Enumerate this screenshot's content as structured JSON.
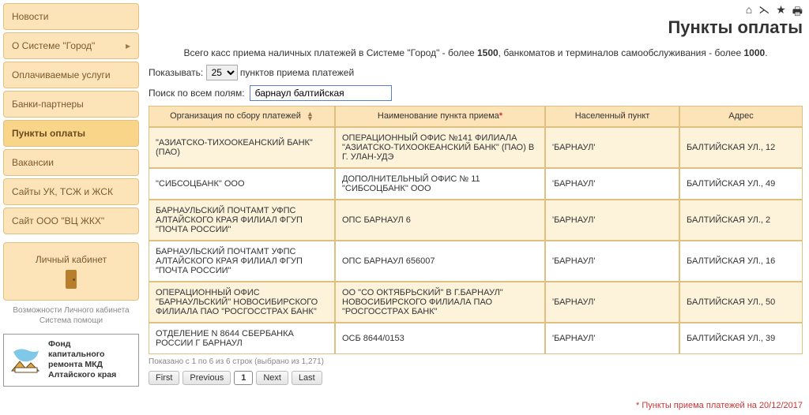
{
  "top_icons": [
    "home",
    "rss",
    "star",
    "print"
  ],
  "page_title": "Пункты оплаты",
  "menu": [
    {
      "label": "Новости",
      "children": false,
      "active": false
    },
    {
      "label": "О Системе \"Город\"",
      "children": true,
      "active": false
    },
    {
      "label": "Оплачиваемые услуги",
      "children": false,
      "active": false
    },
    {
      "label": "Банки-партнеры",
      "children": false,
      "active": false
    },
    {
      "label": "Пункты оплаты",
      "children": false,
      "active": true
    },
    {
      "label": "Вакансии",
      "children": false,
      "active": false
    },
    {
      "label": "Сайты УК, ТСЖ и ЖСК",
      "children": false,
      "active": false
    },
    {
      "label": "Сайт ООО \"ВЦ ЖКХ\"",
      "children": false,
      "active": false
    }
  ],
  "cabinet_label": "Личный кабинет",
  "cabinet_hint": "Возможности Личного кабинета\nСистема помощи",
  "logo_lines": {
    "l1": "Фонд",
    "l2": "капитального",
    "l3": "ремонта МКД",
    "l4": "Алтайского края"
  },
  "intro": {
    "pre": "Всего касс приема наличных платежей в Системе \"Город\" - более ",
    "b1": "1500",
    "mid": ", банкоматов и терминалов самообслуживания - более ",
    "b2": "1000",
    "post": "."
  },
  "show": {
    "label_pre": "Показывать:",
    "value": "25",
    "label_post": "пунктов приема платежей"
  },
  "search": {
    "label": "Поиск по всем полям:",
    "value": "барнаул балтийская"
  },
  "columns": {
    "org": "Организация по сбору платежей",
    "name": "Наименование пункта приема",
    "city": "Населенный пункт",
    "addr": "Адрес"
  },
  "rows": [
    {
      "org": "\"АЗИАТСКО-ТИХООКЕАНСКИЙ БАНК\" (ПАО)",
      "name": "ОПЕРАЦИОННЫЙ ОФИС №141 ФИЛИАЛА \"АЗИАТСКО-ТИХООКЕАНСКИЙ БАНК\" (ПАО) В Г. УЛАН-УДЭ",
      "city": "'БАРНАУЛ'",
      "addr": "БАЛТИЙСКАЯ УЛ., 12"
    },
    {
      "org": "\"СИБСОЦБАНК\" ООО",
      "name": "ДОПОЛНИТЕЛЬНЫЙ ОФИС № 11 \"СИБСОЦБАНК\" ООО",
      "city": "'БАРНАУЛ'",
      "addr": "БАЛТИЙСКАЯ УЛ., 49"
    },
    {
      "org": "БАРНАУЛЬСКИЙ ПОЧТАМТ УФПС АЛТАЙСКОГО КРАЯ ФИЛИАЛ ФГУП \"ПОЧТА РОССИИ\"",
      "name": "ОПС БАРНАУЛ 6",
      "city": "'БАРНАУЛ'",
      "addr": "БАЛТИЙСКАЯ УЛ., 2"
    },
    {
      "org": "БАРНАУЛЬСКИЙ ПОЧТАМТ УФПС АЛТАЙСКОГО КРАЯ ФИЛИАЛ ФГУП \"ПОЧТА РОССИИ\"",
      "name": "ОПС БАРНАУЛ 656007",
      "city": "'БАРНАУЛ'",
      "addr": "БАЛТИЙСКАЯ УЛ., 16"
    },
    {
      "org": "ОПЕРАЦИОННЫЙ ОФИС \"БАРНАУЛЬСКИЙ\" НОВОСИБИРСКОГО ФИЛИАЛА ПАО \"РОСГОССТРАХ БАНК\"",
      "name": "ОО \"СО ОКТЯБРЬСКИЙ\" В Г.БАРНАУЛ\" НОВОСИБИРСКОГО ФИЛИАЛА ПАО \"РОСГОССТРАХ БАНК\"",
      "city": "'БАРНАУЛ'",
      "addr": "БАЛТИЙСКАЯ УЛ., 50"
    },
    {
      "org": "ОТДЕЛЕНИЕ N 8644 СБЕРБАНКА РОССИИ Г БАРНАУЛ",
      "name": "ОСБ 8644/0153",
      "city": "'БАРНАУЛ'",
      "addr": "БАЛТИЙСКАЯ УЛ., 39"
    }
  ],
  "table_footer": "Показано с 1 по 6 из 6 строк (выбрано из 1,271)",
  "pager": {
    "first": "First",
    "prev": "Previous",
    "page": "1",
    "next": "Next",
    "last": "Last"
  },
  "footnote": "* Пункты приема платежей на 20/12/2017"
}
